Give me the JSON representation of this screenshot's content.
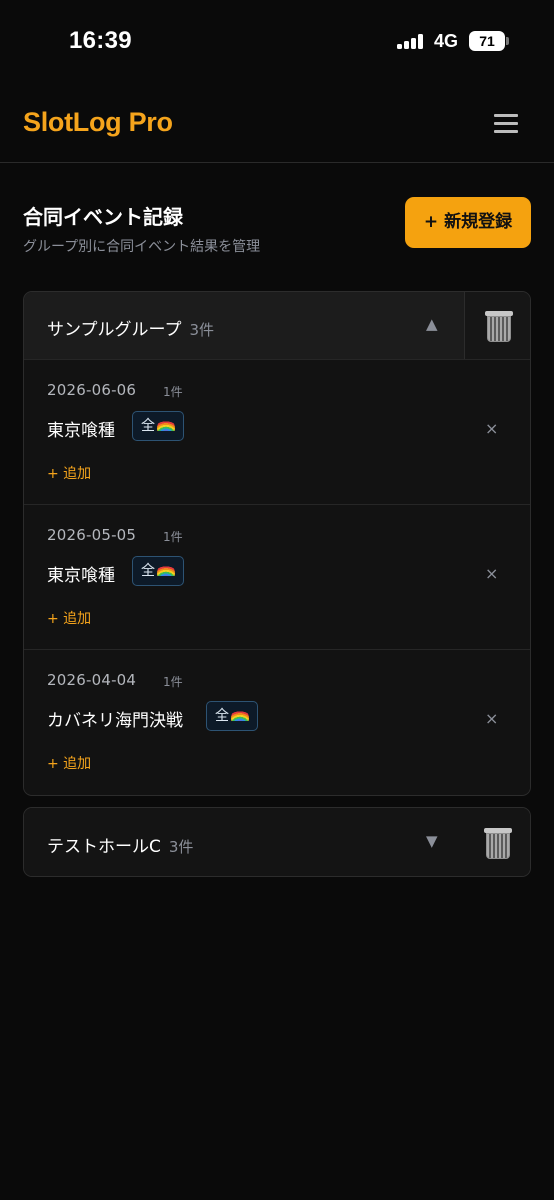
{
  "status_bar": {
    "time": "16:39",
    "network": "4G",
    "battery": "71"
  },
  "header": {
    "app_title": "SlotLog Pro"
  },
  "page": {
    "title": "合同イベント記録",
    "subtitle": "グループ別に合同イベント結果を管理",
    "new_button_label": "+ 新規登録"
  },
  "groups": [
    {
      "name": "サンプルグループ",
      "count": "3件",
      "chevron": "▲",
      "events": [
        {
          "date": "2026-06-06",
          "count": "1件",
          "name": "東京喰種",
          "tag": "全",
          "add_label": "+ 追加",
          "delete_icon": "×"
        },
        {
          "date": "2026-05-05",
          "count": "1件",
          "name": "東京喰種",
          "tag": "全",
          "add_label": "+ 追加",
          "delete_icon": "×"
        },
        {
          "date": "2026-04-04",
          "count": "1件",
          "name": "カバネリ海門決戦",
          "tag": "全",
          "add_label": "+ 追加",
          "delete_icon": "×"
        }
      ]
    },
    {
      "name": "テストホールC",
      "count": "3件",
      "chevron": "▼"
    }
  ],
  "colors": {
    "accent": "#f5a41c",
    "background": "#0a0a0a",
    "tag_border": "#2d5373"
  },
  "icons": {
    "menu": "hamburger-menu-icon",
    "trash": "trash-can-icon",
    "tag_emoji": "rainbow-icon"
  }
}
